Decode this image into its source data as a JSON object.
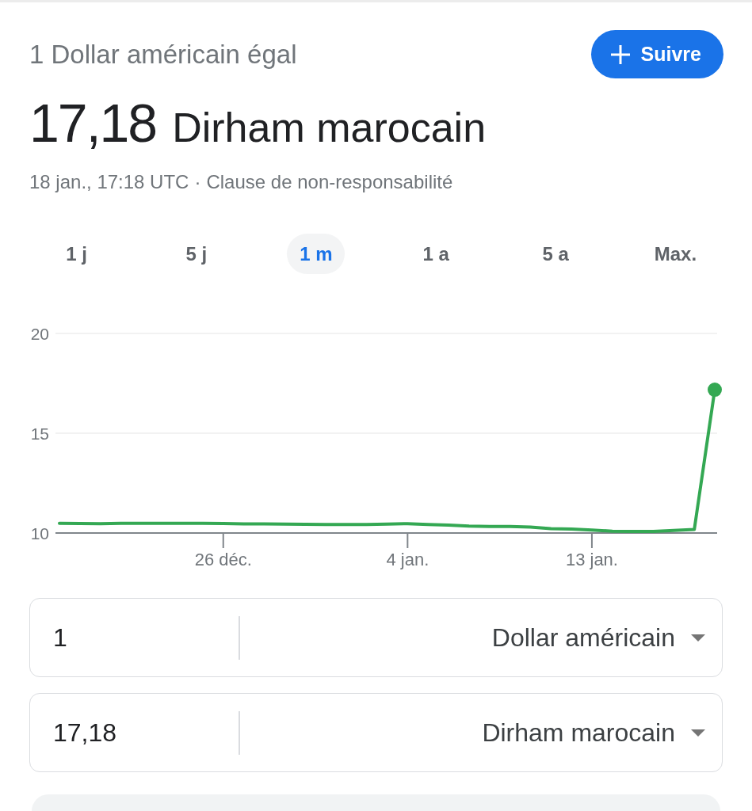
{
  "header": {
    "title": "1 Dollar américain égal",
    "follow_button": {
      "label": "Suivre"
    }
  },
  "rate": {
    "value": "17,18",
    "currency": "Dirham marocain"
  },
  "updated": {
    "timestamp": "18 jan., 17:18 UTC",
    "separator": "·",
    "disclaimer_link": "Clause de non-responsabilité"
  },
  "range_tabs": [
    {
      "label": "1 j",
      "selected": false
    },
    {
      "label": "5 j",
      "selected": false
    },
    {
      "label": "1 m",
      "selected": true
    },
    {
      "label": "1 a",
      "selected": false
    },
    {
      "label": "5 a",
      "selected": false
    },
    {
      "label": "Max.",
      "selected": false
    }
  ],
  "chart": {
    "chart_data": {
      "type": "line",
      "categories": [
        null,
        null,
        null,
        null,
        null,
        null,
        null,
        null,
        "26 déc.",
        null,
        null,
        null,
        null,
        null,
        null,
        null,
        null,
        "4 jan.",
        null,
        null,
        null,
        null,
        null,
        null,
        null,
        null,
        "13 jan.",
        null,
        null,
        null,
        null,
        null,
        null
      ],
      "series": [
        {
          "color": "#34a853",
          "values": [
            10.49,
            10.48,
            10.47,
            10.49,
            10.49,
            10.49,
            10.49,
            10.49,
            10.48,
            10.46,
            10.46,
            10.45,
            10.44,
            10.43,
            10.43,
            10.43,
            10.45,
            10.47,
            10.43,
            10.4,
            10.35,
            10.33,
            10.33,
            10.3,
            10.22,
            10.2,
            10.15,
            10.09,
            10.08,
            10.08,
            10.13,
            10.18,
            17.18
          ]
        }
      ],
      "ylim": [
        10,
        20
      ],
      "yticks": [
        10,
        15,
        20
      ]
    }
  },
  "converter": {
    "rows": [
      {
        "amount": "1",
        "currency": "Dollar américain"
      },
      {
        "amount": "17,18",
        "currency": "Dirham marocain"
      }
    ]
  }
}
